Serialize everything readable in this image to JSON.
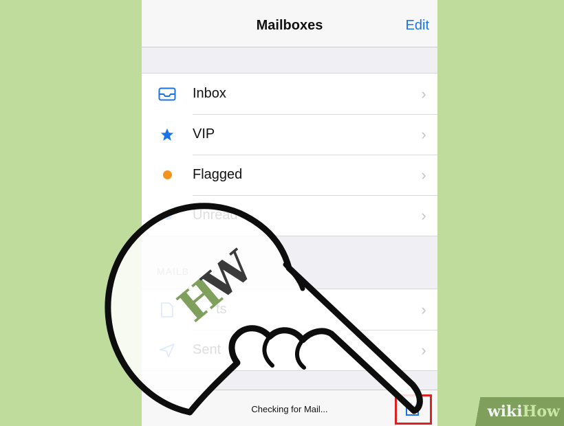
{
  "navbar": {
    "title": "Mailboxes",
    "edit_label": "Edit"
  },
  "mailboxes": [
    {
      "label": "Inbox",
      "icon": "inbox-icon"
    },
    {
      "label": "VIP",
      "icon": "star-icon"
    },
    {
      "label": "Flagged",
      "icon": "flag-dot-icon"
    },
    {
      "label": "Unread",
      "icon": "unread-dot-icon"
    }
  ],
  "section": {
    "heading": "MAILB"
  },
  "accounts": [
    {
      "label": "Drafts",
      "visible_label": "ts",
      "icon": "drafts-icon"
    },
    {
      "label": "Sent",
      "icon": "sent-icon"
    }
  ],
  "toolbar": {
    "status": "Checking for Mail...",
    "compose_icon": "compose-icon"
  },
  "watermark": {
    "wiki": "wiki",
    "how": "How"
  },
  "colors": {
    "accent": "#1a73e8",
    "flag": "#f5921e",
    "highlight": "#e02020",
    "background": "#c0dc9c"
  }
}
